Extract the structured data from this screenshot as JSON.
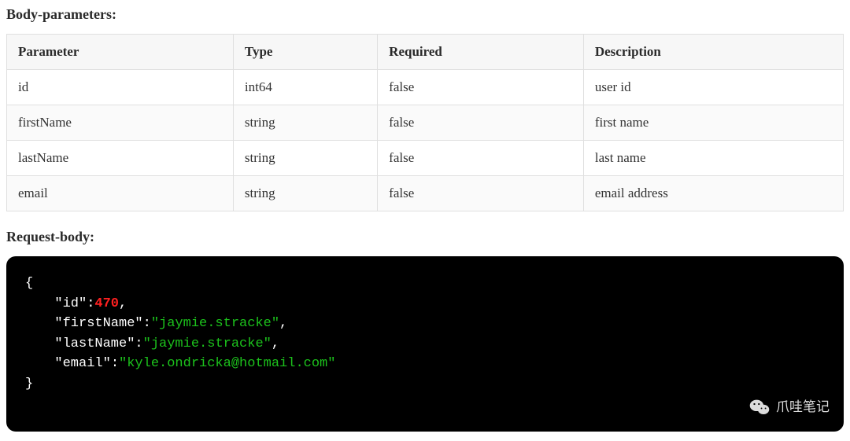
{
  "sections": {
    "body_params_title": "Body-parameters:",
    "request_body_title": "Request-body:"
  },
  "table": {
    "headers": [
      "Parameter",
      "Type",
      "Required",
      "Description"
    ],
    "rows": [
      {
        "parameter": "id",
        "type": "int64",
        "required": "false",
        "description": "user id"
      },
      {
        "parameter": "firstName",
        "type": "string",
        "required": "false",
        "description": "first name"
      },
      {
        "parameter": "lastName",
        "type": "string",
        "required": "false",
        "description": "last name"
      },
      {
        "parameter": "email",
        "type": "string",
        "required": "false",
        "description": "email address"
      }
    ]
  },
  "request_body": {
    "id": {
      "key": "\"id\"",
      "value": "470",
      "value_type": "number"
    },
    "firstName": {
      "key": "\"firstName\"",
      "value": "\"jaymie.stracke\"",
      "value_type": "string"
    },
    "lastName": {
      "key": "\"lastName\"",
      "value": "\"jaymie.stracke\"",
      "value_type": "string"
    },
    "email": {
      "key": "\"email\"",
      "value": "\"kyle.ondricka@hotmail.com\"",
      "value_type": "string"
    }
  },
  "watermark": {
    "text": "爪哇笔记"
  }
}
